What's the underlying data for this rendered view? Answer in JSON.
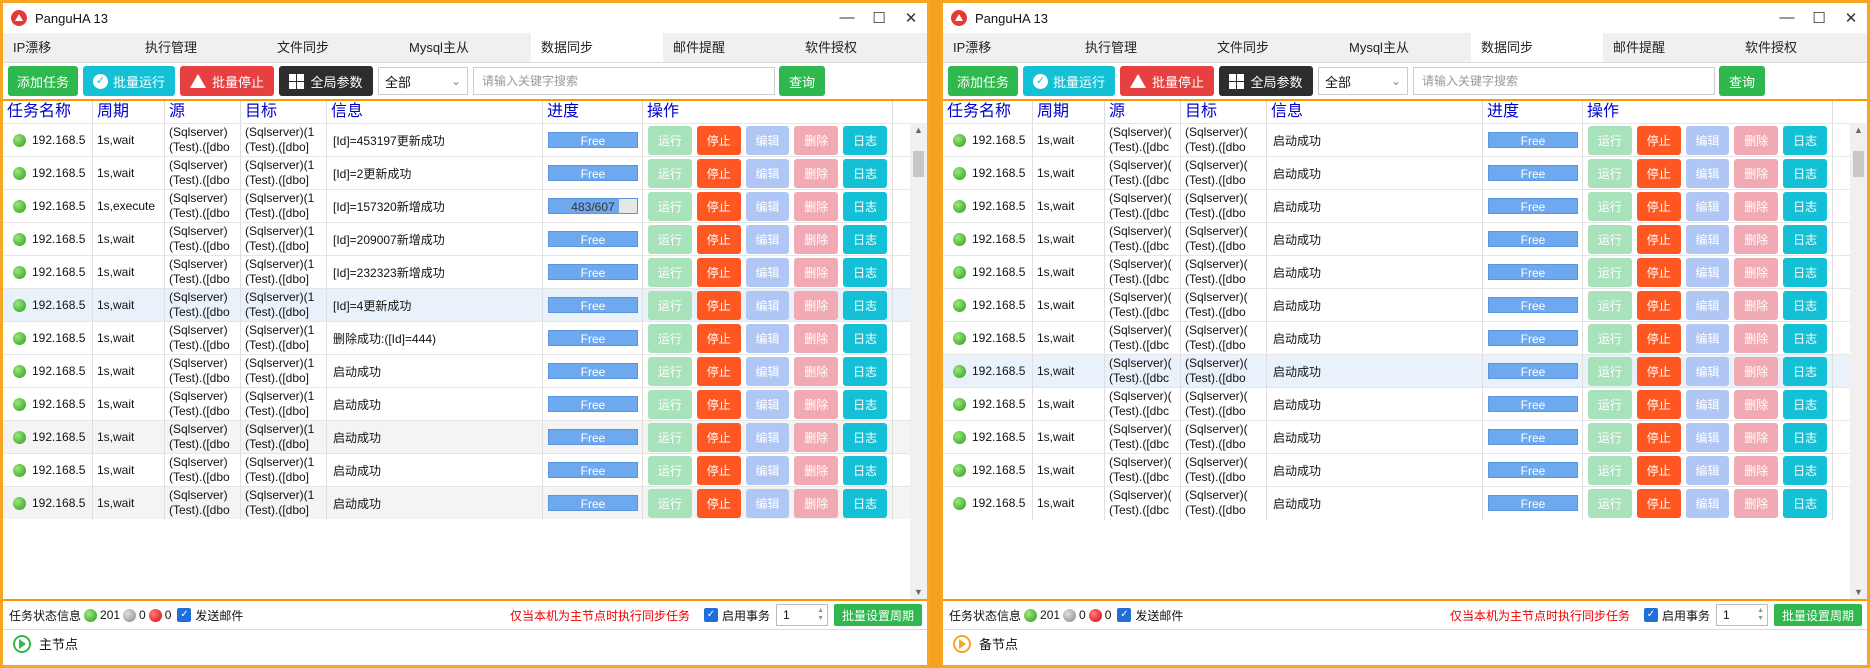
{
  "windows": [
    {
      "title": "PanguHA 13",
      "tabs": [
        "IP漂移",
        "执行管理",
        "文件同步",
        "Mysql主从",
        "数据同步",
        "邮件提醒",
        "软件授权"
      ],
      "active_tab": 4,
      "toolbar": {
        "add": "添加任务",
        "batch_run": "批量运行",
        "batch_stop": "批量停止",
        "global_params": "全局参数",
        "filter": "全部",
        "search_placeholder": "请输入关键字搜索",
        "query": "查询"
      },
      "columns": [
        "任务名称",
        "周期",
        "源",
        "目标",
        "信息",
        "进度",
        "操作"
      ],
      "actions": [
        "运行",
        "停止",
        "编辑",
        "删除",
        "日志"
      ],
      "rows": [
        {
          "name": "192.168.5",
          "period": "1s,wait",
          "src1": "(Sqlserver)",
          "src2": "(Test).([dbo",
          "dst1": "(Sqlserver)(1",
          "dst2": "(Test).([dbo]",
          "info": "[Id]=453197更新成功",
          "progress": "Free"
        },
        {
          "name": "192.168.5",
          "period": "1s,wait",
          "src1": "(Sqlserver)",
          "src2": "(Test).([dbo",
          "dst1": "(Sqlserver)(1",
          "dst2": "(Test).([dbo]",
          "info": "[Id]=2更新成功",
          "progress": "Free"
        },
        {
          "name": "192.168.5",
          "period": "1s,execute",
          "src1": "(Sqlserver)",
          "src2": "(Test).([dbo",
          "dst1": "(Sqlserver)(1",
          "dst2": "(Test).([dbo]",
          "info": "[Id]=157320新增成功",
          "progress": "483/607",
          "progress_fraction": 0.796
        },
        {
          "name": "192.168.5",
          "period": "1s,wait",
          "src1": "(Sqlserver)",
          "src2": "(Test).([dbo",
          "dst1": "(Sqlserver)(1",
          "dst2": "(Test).([dbo]",
          "info": "[Id]=209007新增成功",
          "progress": "Free"
        },
        {
          "name": "192.168.5",
          "period": "1s,wait",
          "src1": "(Sqlserver)",
          "src2": "(Test).([dbo",
          "dst1": "(Sqlserver)(1",
          "dst2": "(Test).([dbo]",
          "info": "[Id]=232323新增成功",
          "progress": "Free"
        },
        {
          "name": "192.168.5",
          "period": "1s,wait",
          "src1": "(Sqlserver)",
          "src2": "(Test).([dbo",
          "dst1": "(Sqlserver)(1",
          "dst2": "(Test).([dbo]",
          "info": "[Id]=4更新成功",
          "progress": "Free"
        },
        {
          "name": "192.168.5",
          "period": "1s,wait",
          "src1": "(Sqlserver)",
          "src2": "(Test).([dbo",
          "dst1": "(Sqlserver)(1",
          "dst2": "(Test).([dbo]",
          "info": "删除成功:([Id]=444)",
          "progress": "Free"
        },
        {
          "name": "192.168.5",
          "period": "1s,wait",
          "src1": "(Sqlserver)",
          "src2": "(Test).([dbo",
          "dst1": "(Sqlserver)(1",
          "dst2": "(Test).([dbo]",
          "info": "启动成功",
          "progress": "Free"
        },
        {
          "name": "192.168.5",
          "period": "1s,wait",
          "src1": "(Sqlserver)",
          "src2": "(Test).([dbo",
          "dst1": "(Sqlserver)(1",
          "dst2": "(Test).([dbo]",
          "info": "启动成功",
          "progress": "Free"
        },
        {
          "name": "192.168.5",
          "period": "1s,wait",
          "src1": "(Sqlserver)",
          "src2": "(Test).([dbo",
          "dst1": "(Sqlserver)(1",
          "dst2": "(Test).([dbo]",
          "info": "启动成功",
          "progress": "Free"
        },
        {
          "name": "192.168.5",
          "period": "1s,wait",
          "src1": "(Sqlserver)",
          "src2": "(Test).([dbo",
          "dst1": "(Sqlserver)(1",
          "dst2": "(Test).([dbo]",
          "info": "启动成功",
          "progress": "Free"
        },
        {
          "name": "192.168.5",
          "period": "1s,wait",
          "src1": "(Sqlserver)",
          "src2": "(Test).([dbo",
          "dst1": "(Sqlserver)(1",
          "dst2": "(Test).([dbo]",
          "info": "启动成功",
          "progress": "Free"
        }
      ],
      "status": {
        "label": "任务状态信息",
        "green": "201",
        "gray": "0",
        "red": "0",
        "send_mail": "发送邮件",
        "warning": "仅当本机为主节点时执行同步任务",
        "enable_tx": "启用事务",
        "period_value": "1",
        "batch_period": "批量设置周期"
      },
      "node": "主节点"
    },
    {
      "title": "PanguHA 13",
      "tabs": [
        "IP漂移",
        "执行管理",
        "文件同步",
        "Mysql主从",
        "数据同步",
        "邮件提醒",
        "软件授权"
      ],
      "active_tab": 4,
      "toolbar": {
        "add": "添加任务",
        "batch_run": "批量运行",
        "batch_stop": "批量停止",
        "global_params": "全局参数",
        "filter": "全部",
        "search_placeholder": "请输入关键字搜索",
        "query": "查询"
      },
      "columns": [
        "任务名称",
        "周期",
        "源",
        "目标",
        "信息",
        "进度",
        "操作"
      ],
      "actions": [
        "运行",
        "停止",
        "编辑",
        "删除",
        "日志"
      ],
      "rows": [
        {
          "name": "192.168.5",
          "period": "1s,wait",
          "src1": "(Sqlserver)(",
          "src2": "(Test).([dbc",
          "dst1": "(Sqlserver)(",
          "dst2": "(Test).([dbo",
          "info": "启动成功",
          "progress": "Free"
        },
        {
          "name": "192.168.5",
          "period": "1s,wait",
          "src1": "(Sqlserver)(",
          "src2": "(Test).([dbc",
          "dst1": "(Sqlserver)(",
          "dst2": "(Test).([dbo",
          "info": "启动成功",
          "progress": "Free"
        },
        {
          "name": "192.168.5",
          "period": "1s,wait",
          "src1": "(Sqlserver)(",
          "src2": "(Test).([dbc",
          "dst1": "(Sqlserver)(",
          "dst2": "(Test).([dbo",
          "info": "启动成功",
          "progress": "Free"
        },
        {
          "name": "192.168.5",
          "period": "1s,wait",
          "src1": "(Sqlserver)(",
          "src2": "(Test).([dbc",
          "dst1": "(Sqlserver)(",
          "dst2": "(Test).([dbo",
          "info": "启动成功",
          "progress": "Free"
        },
        {
          "name": "192.168.5",
          "period": "1s,wait",
          "src1": "(Sqlserver)(",
          "src2": "(Test).([dbc",
          "dst1": "(Sqlserver)(",
          "dst2": "(Test).([dbo",
          "info": "启动成功",
          "progress": "Free"
        },
        {
          "name": "192.168.5",
          "period": "1s,wait",
          "src1": "(Sqlserver)(",
          "src2": "(Test).([dbc",
          "dst1": "(Sqlserver)(",
          "dst2": "(Test).([dbo",
          "info": "启动成功",
          "progress": "Free"
        },
        {
          "name": "192.168.5",
          "period": "1s,wait",
          "src1": "(Sqlserver)(",
          "src2": "(Test).([dbc",
          "dst1": "(Sqlserver)(",
          "dst2": "(Test).([dbo",
          "info": "启动成功",
          "progress": "Free"
        },
        {
          "name": "192.168.5",
          "period": "1s,wait",
          "src1": "(Sqlserver)(",
          "src2": "(Test).([dbc",
          "dst1": "(Sqlserver)(",
          "dst2": "(Test).([dbo",
          "info": "启动成功",
          "progress": "Free"
        },
        {
          "name": "192.168.5",
          "period": "1s,wait",
          "src1": "(Sqlserver)(",
          "src2": "(Test).([dbc",
          "dst1": "(Sqlserver)(",
          "dst2": "(Test).([dbo",
          "info": "启动成功",
          "progress": "Free"
        },
        {
          "name": "192.168.5",
          "period": "1s,wait",
          "src1": "(Sqlserver)(",
          "src2": "(Test).([dbc",
          "dst1": "(Sqlserver)(",
          "dst2": "(Test).([dbo",
          "info": "启动成功",
          "progress": "Free"
        },
        {
          "name": "192.168.5",
          "period": "1s,wait",
          "src1": "(Sqlserver)(",
          "src2": "(Test).([dbc",
          "dst1": "(Sqlserver)(",
          "dst2": "(Test).([dbo",
          "info": "启动成功",
          "progress": "Free"
        },
        {
          "name": "192.168.5",
          "period": "1s,wait",
          "src1": "(Sqlserver)(",
          "src2": "(Test).([dbc",
          "dst1": "(Sqlserver)(",
          "dst2": "(Test).([dbo",
          "info": "启动成功",
          "progress": "Free"
        }
      ],
      "status": {
        "label": "任务状态信息",
        "green": "201",
        "gray": "0",
        "red": "0",
        "send_mail": "发送邮件",
        "warning": "仅当本机为主节点时执行同步任务",
        "enable_tx": "启用事务",
        "period_value": "1",
        "batch_period": "批量设置周期"
      },
      "node": "备节点"
    }
  ]
}
